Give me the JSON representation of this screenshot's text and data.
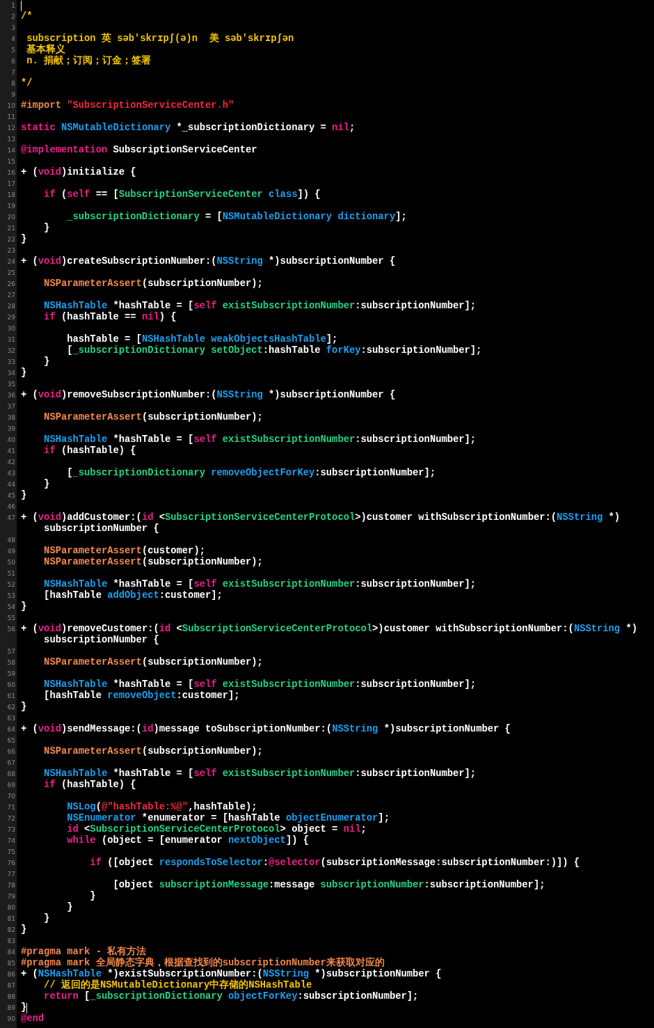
{
  "editor": {
    "lines": [
      {
        "number": "1",
        "cursor": true
      },
      {
        "number": "2",
        "cursor": false,
        "tokens": [
          {
            "kind": "comment",
            "text": "/*"
          }
        ]
      },
      {
        "number": "3",
        "cursor": false
      },
      {
        "number": "4",
        "cursor": false,
        "tokens": [
          {
            "kind": "comment",
            "text": " subscription 英 səb'skrɪpʃ(ə)n  美 səb'skrɪpʃən"
          }
        ]
      },
      {
        "number": "5",
        "cursor": false,
        "tokens": [
          {
            "kind": "comment",
            "text": " 基本释义"
          }
        ]
      },
      {
        "number": "6",
        "cursor": false,
        "tokens": [
          {
            "kind": "comment",
            "text": " n. 捐献；订阅；订金；签署"
          }
        ]
      },
      {
        "number": "7",
        "cursor": false
      },
      {
        "number": "8",
        "cursor": false,
        "tokens": [
          {
            "kind": "comment",
            "text": "*/"
          }
        ]
      },
      {
        "number": "9",
        "cursor": false
      },
      {
        "number": "10",
        "cursor": false,
        "tokens": [
          {
            "kind": "directive",
            "text": "#import "
          },
          {
            "kind": "string",
            "text": "\"SubscriptionServiceCenter.h\""
          }
        ]
      },
      {
        "number": "11",
        "cursor": false
      },
      {
        "number": "12",
        "cursor": false,
        "tokens": [
          {
            "kind": "keyword",
            "text": "static"
          },
          {
            "kind": "system",
            "text": " NSMutableDictionary"
          },
          {
            "kind": "plain",
            "text": " *_subscriptionDictionary = "
          },
          {
            "kind": "keyword",
            "text": "nil"
          },
          {
            "kind": "plain",
            "text": ";"
          }
        ]
      },
      {
        "number": "13",
        "cursor": false
      },
      {
        "number": "14",
        "cursor": false,
        "tokens": [
          {
            "kind": "keyword",
            "text": "@implementation"
          },
          {
            "kind": "plain",
            "text": " SubscriptionServiceCenter"
          }
        ]
      },
      {
        "number": "15",
        "cursor": false
      },
      {
        "number": "16",
        "cursor": false,
        "tokens": [
          {
            "kind": "plain",
            "text": "+ ("
          },
          {
            "kind": "keyword",
            "text": "void"
          },
          {
            "kind": "plain",
            "text": ")initialize {"
          }
        ]
      },
      {
        "number": "17",
        "cursor": false
      },
      {
        "number": "18",
        "cursor": false,
        "tokens": [
          {
            "kind": "keyword",
            "text": "    if"
          },
          {
            "kind": "plain",
            "text": " ("
          },
          {
            "kind": "keyword",
            "text": "self"
          },
          {
            "kind": "plain",
            "text": " == ["
          },
          {
            "kind": "project",
            "text": "SubscriptionServiceCenter"
          },
          {
            "kind": "system",
            "text": " class"
          },
          {
            "kind": "plain",
            "text": "]) {"
          }
        ]
      },
      {
        "number": "19",
        "cursor": false
      },
      {
        "number": "20",
        "cursor": false,
        "tokens": [
          {
            "kind": "project",
            "text": "        _subscriptionDictionary"
          },
          {
            "kind": "plain",
            "text": " = ["
          },
          {
            "kind": "system",
            "text": "NSMutableDictionary"
          },
          {
            "kind": "system",
            "text": " dictionary"
          },
          {
            "kind": "plain",
            "text": "];"
          }
        ]
      },
      {
        "number": "21",
        "cursor": false,
        "tokens": [
          {
            "kind": "plain",
            "text": "    }"
          }
        ]
      },
      {
        "number": "22",
        "cursor": false,
        "tokens": [
          {
            "kind": "plain",
            "text": "}"
          }
        ]
      },
      {
        "number": "23",
        "cursor": false
      },
      {
        "number": "24",
        "cursor": false,
        "tokens": [
          {
            "kind": "plain",
            "text": "+ ("
          },
          {
            "kind": "keyword",
            "text": "void"
          },
          {
            "kind": "plain",
            "text": ")createSubscriptionNumber:("
          },
          {
            "kind": "system",
            "text": "NSString"
          },
          {
            "kind": "plain",
            "text": " *)subscriptionNumber {"
          }
        ]
      },
      {
        "number": "25",
        "cursor": false
      },
      {
        "number": "26",
        "cursor": false,
        "tokens": [
          {
            "kind": "macro",
            "text": "    NSParameterAssert"
          },
          {
            "kind": "plain",
            "text": "(subscriptionNumber);"
          }
        ]
      },
      {
        "number": "27",
        "cursor": false
      },
      {
        "number": "28",
        "cursor": false,
        "tokens": [
          {
            "kind": "system",
            "text": "    NSHashTable"
          },
          {
            "kind": "plain",
            "text": " *hashTable = ["
          },
          {
            "kind": "keyword",
            "text": "self"
          },
          {
            "kind": "project",
            "text": " existSubscriptionNumber"
          },
          {
            "kind": "plain",
            "text": ":subscriptionNumber];"
          }
        ]
      },
      {
        "number": "29",
        "cursor": false,
        "tokens": [
          {
            "kind": "keyword",
            "text": "    if"
          },
          {
            "kind": "plain",
            "text": " (hashTable == "
          },
          {
            "kind": "keyword",
            "text": "nil"
          },
          {
            "kind": "plain",
            "text": ") {"
          }
        ]
      },
      {
        "number": "30",
        "cursor": false
      },
      {
        "number": "31",
        "cursor": false,
        "tokens": [
          {
            "kind": "plain",
            "text": "        hashTable = ["
          },
          {
            "kind": "system",
            "text": "NSHashTable"
          },
          {
            "kind": "system",
            "text": " weakObjectsHashTable"
          },
          {
            "kind": "plain",
            "text": "];"
          }
        ]
      },
      {
        "number": "32",
        "cursor": false,
        "tokens": [
          {
            "kind": "plain",
            "text": "        ["
          },
          {
            "kind": "project",
            "text": "_subscriptionDictionary"
          },
          {
            "kind": "project",
            "text": " setObject"
          },
          {
            "kind": "plain",
            "text": ":hashTable "
          },
          {
            "kind": "system",
            "text": "forKey"
          },
          {
            "kind": "plain",
            "text": ":subscriptionNumber];"
          }
        ]
      },
      {
        "number": "33",
        "cursor": false,
        "tokens": [
          {
            "kind": "plain",
            "text": "    }"
          }
        ]
      },
      {
        "number": "34",
        "cursor": false,
        "tokens": [
          {
            "kind": "plain",
            "text": "}"
          }
        ]
      },
      {
        "number": "35",
        "cursor": false
      },
      {
        "number": "36",
        "cursor": false,
        "tokens": [
          {
            "kind": "plain",
            "text": "+ ("
          },
          {
            "kind": "keyword",
            "text": "void"
          },
          {
            "kind": "plain",
            "text": ")removeSubscriptionNumber:("
          },
          {
            "kind": "system",
            "text": "NSString"
          },
          {
            "kind": "plain",
            "text": " *)subscriptionNumber {"
          }
        ]
      },
      {
        "number": "37",
        "cursor": false
      },
      {
        "number": "38",
        "cursor": false,
        "tokens": [
          {
            "kind": "macro",
            "text": "    NSParameterAssert"
          },
          {
            "kind": "plain",
            "text": "(subscriptionNumber);"
          }
        ]
      },
      {
        "number": "39",
        "cursor": false
      },
      {
        "number": "40",
        "cursor": false,
        "tokens": [
          {
            "kind": "system",
            "text": "    NSHashTable"
          },
          {
            "kind": "plain",
            "text": " *hashTable = ["
          },
          {
            "kind": "keyword",
            "text": "self"
          },
          {
            "kind": "project",
            "text": " existSubscriptionNumber"
          },
          {
            "kind": "plain",
            "text": ":subscriptionNumber];"
          }
        ]
      },
      {
        "number": "41",
        "cursor": false,
        "tokens": [
          {
            "kind": "keyword",
            "text": "    if"
          },
          {
            "kind": "plain",
            "text": " (hashTable) {"
          }
        ]
      },
      {
        "number": "42",
        "cursor": false
      },
      {
        "number": "43",
        "cursor": false,
        "tokens": [
          {
            "kind": "plain",
            "text": "        ["
          },
          {
            "kind": "project",
            "text": "_subscriptionDictionary"
          },
          {
            "kind": "system",
            "text": " removeObjectForKey"
          },
          {
            "kind": "plain",
            "text": ":subscriptionNumber];"
          }
        ]
      },
      {
        "number": "44",
        "cursor": false,
        "tokens": [
          {
            "kind": "plain",
            "text": "    }"
          }
        ]
      },
      {
        "number": "45",
        "cursor": false,
        "tokens": [
          {
            "kind": "plain",
            "text": "}"
          }
        ]
      },
      {
        "number": "46",
        "cursor": false
      },
      {
        "number": "47",
        "cursor": false,
        "tokens": [
          {
            "kind": "plain",
            "text": "+ ("
          },
          {
            "kind": "keyword",
            "text": "void"
          },
          {
            "kind": "plain",
            "text": ")addCustomer:("
          },
          {
            "kind": "keyword",
            "text": "id"
          },
          {
            "kind": "plain",
            "text": " <"
          },
          {
            "kind": "project",
            "text": "SubscriptionServiceCenterProtocol"
          },
          {
            "kind": "plain",
            "text": ">)customer withSubscriptionNumber:("
          },
          {
            "kind": "system",
            "text": "NSString"
          },
          {
            "kind": "plain",
            "text": " *)"
          }
        ],
        "continuation": [
          {
            "kind": "plain",
            "text": "    subscriptionNumber {"
          }
        ]
      },
      {
        "number": "48",
        "cursor": false
      },
      {
        "number": "49",
        "cursor": false,
        "tokens": [
          {
            "kind": "macro",
            "text": "    NSParameterAssert"
          },
          {
            "kind": "plain",
            "text": "(customer);"
          }
        ]
      },
      {
        "number": "50",
        "cursor": false,
        "tokens": [
          {
            "kind": "macro",
            "text": "    NSParameterAssert"
          },
          {
            "kind": "plain",
            "text": "(subscriptionNumber);"
          }
        ]
      },
      {
        "number": "51",
        "cursor": false
      },
      {
        "number": "52",
        "cursor": false,
        "tokens": [
          {
            "kind": "system",
            "text": "    NSHashTable"
          },
          {
            "kind": "plain",
            "text": " *hashTable = ["
          },
          {
            "kind": "keyword",
            "text": "self"
          },
          {
            "kind": "project",
            "text": " existSubscriptionNumber"
          },
          {
            "kind": "plain",
            "text": ":subscriptionNumber];"
          }
        ]
      },
      {
        "number": "53",
        "cursor": false,
        "tokens": [
          {
            "kind": "plain",
            "text": "    [hashTable "
          },
          {
            "kind": "system",
            "text": "addObject"
          },
          {
            "kind": "plain",
            "text": ":customer];"
          }
        ]
      },
      {
        "number": "54",
        "cursor": false,
        "tokens": [
          {
            "kind": "plain",
            "text": "}"
          }
        ]
      },
      {
        "number": "55",
        "cursor": false
      },
      {
        "number": "56",
        "cursor": false,
        "tokens": [
          {
            "kind": "plain",
            "text": "+ ("
          },
          {
            "kind": "keyword",
            "text": "void"
          },
          {
            "kind": "plain",
            "text": ")removeCustomer:("
          },
          {
            "kind": "keyword",
            "text": "id"
          },
          {
            "kind": "plain",
            "text": " <"
          },
          {
            "kind": "project",
            "text": "SubscriptionServiceCenterProtocol"
          },
          {
            "kind": "plain",
            "text": ">)customer withSubscriptionNumber:("
          },
          {
            "kind": "system",
            "text": "NSString"
          },
          {
            "kind": "plain",
            "text": " *)"
          }
        ],
        "continuation": [
          {
            "kind": "plain",
            "text": "    subscriptionNumber {"
          }
        ]
      },
      {
        "number": "57",
        "cursor": false
      },
      {
        "number": "58",
        "cursor": false,
        "tokens": [
          {
            "kind": "macro",
            "text": "    NSParameterAssert"
          },
          {
            "kind": "plain",
            "text": "(subscriptionNumber);"
          }
        ]
      },
      {
        "number": "59",
        "cursor": false
      },
      {
        "number": "60",
        "cursor": false,
        "tokens": [
          {
            "kind": "system",
            "text": "    NSHashTable"
          },
          {
            "kind": "plain",
            "text": " *hashTable = ["
          },
          {
            "kind": "keyword",
            "text": "self"
          },
          {
            "kind": "project",
            "text": " existSubscriptionNumber"
          },
          {
            "kind": "plain",
            "text": ":subscriptionNumber];"
          }
        ]
      },
      {
        "number": "61",
        "cursor": false,
        "tokens": [
          {
            "kind": "plain",
            "text": "    [hashTable "
          },
          {
            "kind": "system",
            "text": "removeObject"
          },
          {
            "kind": "plain",
            "text": ":customer];"
          }
        ]
      },
      {
        "number": "62",
        "cursor": false,
        "tokens": [
          {
            "kind": "plain",
            "text": "}"
          }
        ]
      },
      {
        "number": "63",
        "cursor": false
      },
      {
        "number": "64",
        "cursor": false,
        "tokens": [
          {
            "kind": "plain",
            "text": "+ ("
          },
          {
            "kind": "keyword",
            "text": "void"
          },
          {
            "kind": "plain",
            "text": ")sendMessage:("
          },
          {
            "kind": "keyword",
            "text": "id"
          },
          {
            "kind": "plain",
            "text": ")message toSubscriptionNumber:("
          },
          {
            "kind": "system",
            "text": "NSString"
          },
          {
            "kind": "plain",
            "text": " *)subscriptionNumber {"
          }
        ]
      },
      {
        "number": "65",
        "cursor": false
      },
      {
        "number": "66",
        "cursor": false,
        "tokens": [
          {
            "kind": "macro",
            "text": "    NSParameterAssert"
          },
          {
            "kind": "plain",
            "text": "(subscriptionNumber);"
          }
        ]
      },
      {
        "number": "67",
        "cursor": false
      },
      {
        "number": "68",
        "cursor": false,
        "tokens": [
          {
            "kind": "system",
            "text": "    NSHashTable"
          },
          {
            "kind": "plain",
            "text": " *hashTable = ["
          },
          {
            "kind": "keyword",
            "text": "self"
          },
          {
            "kind": "project",
            "text": " existSubscriptionNumber"
          },
          {
            "kind": "plain",
            "text": ":subscriptionNumber];"
          }
        ]
      },
      {
        "number": "69",
        "cursor": false,
        "tokens": [
          {
            "kind": "keyword",
            "text": "    if"
          },
          {
            "kind": "plain",
            "text": " (hashTable) {"
          }
        ]
      },
      {
        "number": "70",
        "cursor": false
      },
      {
        "number": "71",
        "cursor": false,
        "tokens": [
          {
            "kind": "system",
            "text": "        NSLog"
          },
          {
            "kind": "plain",
            "text": "("
          },
          {
            "kind": "string",
            "text": "@\"hashTable:%@\""
          },
          {
            "kind": "plain",
            "text": ",hashTable);"
          }
        ]
      },
      {
        "number": "72",
        "cursor": false,
        "tokens": [
          {
            "kind": "system",
            "text": "        NSEnumerator"
          },
          {
            "kind": "plain",
            "text": " *enumerator = [hashTable "
          },
          {
            "kind": "system",
            "text": "objectEnumerator"
          },
          {
            "kind": "plain",
            "text": "];"
          }
        ]
      },
      {
        "number": "73",
        "cursor": false,
        "tokens": [
          {
            "kind": "keyword",
            "text": "        id"
          },
          {
            "kind": "plain",
            "text": " <"
          },
          {
            "kind": "project",
            "text": "SubscriptionServiceCenterProtocol"
          },
          {
            "kind": "plain",
            "text": "> object = "
          },
          {
            "kind": "keyword",
            "text": "nil"
          },
          {
            "kind": "plain",
            "text": ";"
          }
        ]
      },
      {
        "number": "74",
        "cursor": false,
        "tokens": [
          {
            "kind": "keyword",
            "text": "        while"
          },
          {
            "kind": "plain",
            "text": " (object = [enumerator "
          },
          {
            "kind": "system",
            "text": "nextObject"
          },
          {
            "kind": "plain",
            "text": "]) {"
          }
        ]
      },
      {
        "number": "75",
        "cursor": false
      },
      {
        "number": "76",
        "cursor": false,
        "tokens": [
          {
            "kind": "keyword",
            "text": "            if"
          },
          {
            "kind": "plain",
            "text": " ([object "
          },
          {
            "kind": "system",
            "text": "respondsToSelector"
          },
          {
            "kind": "plain",
            "text": ":"
          },
          {
            "kind": "keyword",
            "text": "@selector"
          },
          {
            "kind": "plain",
            "text": "(subscriptionMessage:subscriptionNumber:)]) {"
          }
        ]
      },
      {
        "number": "77",
        "cursor": false
      },
      {
        "number": "78",
        "cursor": false,
        "tokens": [
          {
            "kind": "plain",
            "text": "                [object "
          },
          {
            "kind": "project",
            "text": "subscriptionMessage"
          },
          {
            "kind": "plain",
            "text": ":message "
          },
          {
            "kind": "project",
            "text": "subscriptionNumber"
          },
          {
            "kind": "plain",
            "text": ":subscriptionNumber];"
          }
        ]
      },
      {
        "number": "79",
        "cursor": false,
        "tokens": [
          {
            "kind": "plain",
            "text": "            }"
          }
        ]
      },
      {
        "number": "80",
        "cursor": false,
        "tokens": [
          {
            "kind": "plain",
            "text": "        }"
          }
        ]
      },
      {
        "number": "81",
        "cursor": false,
        "tokens": [
          {
            "kind": "plain",
            "text": "    }"
          }
        ]
      },
      {
        "number": "82",
        "cursor": false,
        "tokens": [
          {
            "kind": "plain",
            "text": "}"
          }
        ]
      },
      {
        "number": "83",
        "cursor": false
      },
      {
        "number": "84",
        "cursor": false,
        "tokens": [
          {
            "kind": "directive",
            "text": "#pragma mark - 私有方法"
          }
        ]
      },
      {
        "number": "85",
        "cursor": false,
        "tokens": [
          {
            "kind": "directive",
            "text": "#pragma mark 全局静态字典，根据查找到的subscriptionNumber来获取对应的"
          }
        ]
      },
      {
        "number": "86",
        "cursor": false,
        "tokens": [
          {
            "kind": "plain",
            "text": "+ ("
          },
          {
            "kind": "system",
            "text": "NSHashTable"
          },
          {
            "kind": "plain",
            "text": " *)existSubscriptionNumber:("
          },
          {
            "kind": "system",
            "text": "NSString"
          },
          {
            "kind": "plain",
            "text": " *)subscriptionNumber {"
          }
        ]
      },
      {
        "number": "87",
        "cursor": false,
        "tokens": [
          {
            "kind": "comment",
            "text": "    // 返回的是NSMutableDictionary中存储的NSHashTable"
          }
        ]
      },
      {
        "number": "88",
        "cursor": false,
        "tokens": [
          {
            "kind": "keyword",
            "text": "    return"
          },
          {
            "kind": "plain",
            "text": " ["
          },
          {
            "kind": "project",
            "text": "_subscriptionDictionary"
          },
          {
            "kind": "system",
            "text": " objectForKey"
          },
          {
            "kind": "plain",
            "text": ":subscriptionNumber];"
          }
        ]
      },
      {
        "number": "89",
        "cursor": true,
        "tokens": [
          {
            "kind": "plain",
            "text": "}"
          }
        ]
      },
      {
        "number": "90",
        "cursor": false,
        "tokens": [
          {
            "kind": "keyword",
            "text": "@end"
          }
        ]
      }
    ]
  }
}
